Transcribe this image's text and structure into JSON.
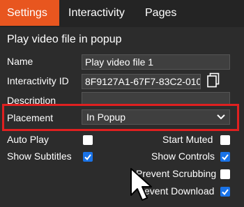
{
  "tabs": [
    "Settings",
    "Interactivity",
    "Pages"
  ],
  "section_title": "Play video file in popup",
  "fields": {
    "name": {
      "label": "Name",
      "value": "Play video file 1"
    },
    "interactivity_id": {
      "label": "Interactivity ID",
      "value": "8F9127A1-67F7-83C2-010"
    },
    "description": {
      "label": "Description",
      "value": ""
    },
    "placement": {
      "label": "Placement",
      "value": "In Popup"
    }
  },
  "options": {
    "auto_play": {
      "label": "Auto Play",
      "checked": false
    },
    "start_muted": {
      "label": "Start Muted",
      "checked": false
    },
    "show_subtitles": {
      "label": "Show Subtitles",
      "checked": true
    },
    "show_controls": {
      "label": "Show Controls",
      "checked": true
    },
    "prevent_scrubbing": {
      "label": "Prevent Scrubbing",
      "checked": false
    },
    "prevent_download": {
      "label": "event Download",
      "checked": true
    }
  },
  "colors": {
    "active_tab": "#e8561f",
    "highlight_border": "#e02020",
    "checkbox_checked": "#1a73e8"
  },
  "icons": [
    "copy-icon",
    "chevron-down-icon",
    "checkmark-icon",
    "mouse-cursor-icon"
  ]
}
